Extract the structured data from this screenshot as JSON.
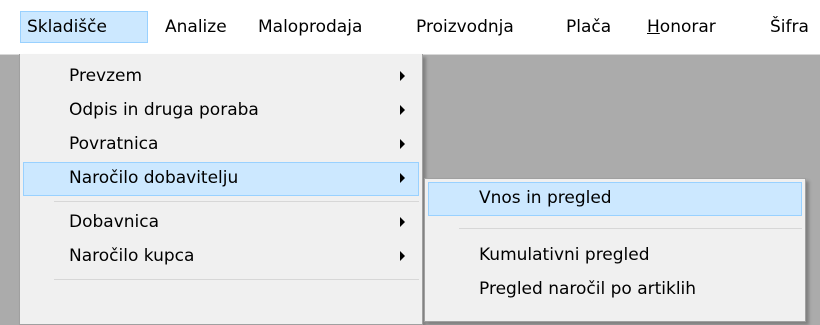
{
  "menubar": {
    "items": [
      {
        "label": "Skladišče"
      },
      {
        "label": "Analize"
      },
      {
        "label": "Maloprodaja"
      },
      {
        "label": "Proizvodnja"
      },
      {
        "label": "Plača"
      },
      {
        "label": "H",
        "rest": "onorar"
      },
      {
        "label": "Šifra"
      }
    ]
  },
  "dropdown": {
    "items": [
      {
        "label": "Prevzem"
      },
      {
        "label": "Odpis in druga poraba"
      },
      {
        "label": "Povratnica"
      },
      {
        "label": "Naročilo dobavitelju"
      },
      {
        "label": "Dobavnica"
      },
      {
        "label": "Naročilo kupca"
      }
    ]
  },
  "submenu": {
    "items": [
      {
        "label": "Vnos in pregled"
      },
      {
        "label": "Kumulativni pregled"
      },
      {
        "label": "Pregled naročil po artiklih"
      }
    ]
  },
  "colors": {
    "highlight_fill": "#cce8ff",
    "highlight_border": "#99d1ff",
    "menu_bg": "#f0f0f0",
    "background": "#ababab"
  }
}
